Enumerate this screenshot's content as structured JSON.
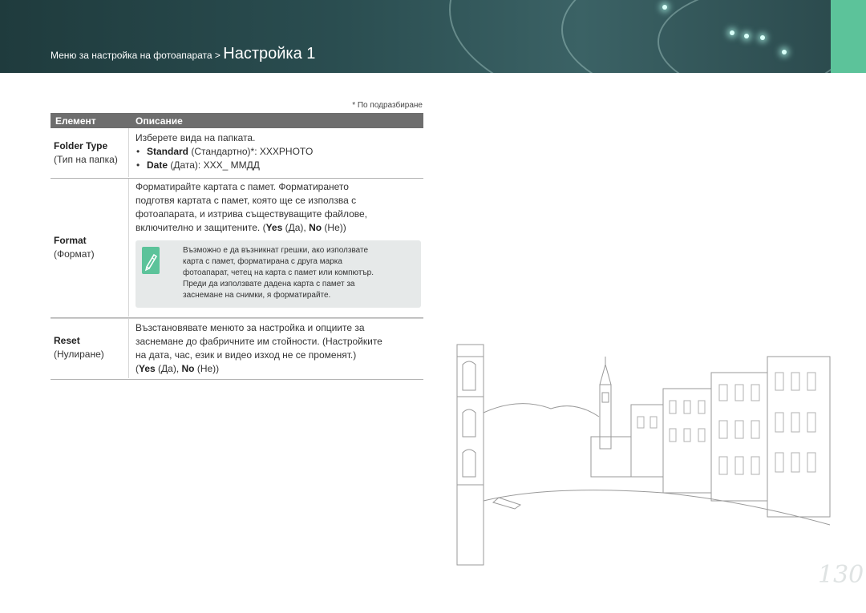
{
  "header": {
    "breadcrumb_prefix": "Меню за настройка на фотоапарата > ",
    "breadcrumb_title": "Настройка 1"
  },
  "default_note": "* По подразбиране",
  "table": {
    "col_item": "Елемент",
    "col_desc": "Описание",
    "rows": [
      {
        "name": "Folder Type",
        "sub": "(Тип на папка)",
        "intro": "Изберете вида на папката.",
        "bullets": [
          {
            "bold": "Standard",
            "rest": " (Стандартно)*: XXXPHOTO"
          },
          {
            "bold": "Date",
            "rest": " (Дата): XXX_ ММДД"
          }
        ]
      },
      {
        "name": "Format",
        "sub": "(Формат)",
        "lines": [
          "Форматирайте картата с памет. Форматирането",
          "подготвя картата с памет, която ще се използва с",
          "фотоапарата, и изтрива съществуващите файлове,"
        ],
        "last_line_start": "включително и защитените. (",
        "yes": "Yes",
        "yes_rest": " (Да), ",
        "no": "No",
        "no_rest": " (Не))",
        "note_lines": [
          "Възможно е да възникнат грешки, ако използвате",
          "карта с памет, форматирана с друга марка",
          "фотоапарат, четец на карта с памет или компютър.",
          "Преди да използвате дадена карта с памет за",
          "заснемане на снимки, я форматирайте."
        ]
      },
      {
        "name": "Reset",
        "sub": "(Нулиране)",
        "lines": [
          "Възстановявате менюто за настройка и опциите за",
          "заснемане до фабричните им стойности. (Настройките",
          "на дата, час, език и видео изход не се променят.)"
        ],
        "yes": "Yes",
        "yes_rest": " (Да), ",
        "no": "No",
        "no_rest": " (Не))",
        "last_line_start": "("
      }
    ]
  },
  "page_number": "130",
  "colors": {
    "header_bg": "#2a4d50",
    "accent_green": "#5cc39a",
    "table_header": "#6e6e6e"
  },
  "icons": [
    "note-pen-icon"
  ]
}
